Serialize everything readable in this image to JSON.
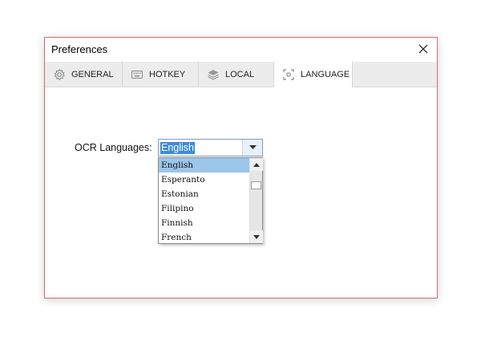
{
  "window": {
    "title": "Preferences"
  },
  "tabs": [
    {
      "label": "GENERAL",
      "icon": "gear-icon",
      "active": false
    },
    {
      "label": "HOTKEY",
      "icon": "keyboard-icon",
      "active": false
    },
    {
      "label": "LOCAL",
      "icon": "layers-icon",
      "active": false
    },
    {
      "label": "LANGUAGE",
      "icon": "scan-icon",
      "active": true
    }
  ],
  "language": {
    "label": "OCR Languages:",
    "selected": "English",
    "options": [
      "English",
      "Esperanto",
      "Estonian",
      "Filipino",
      "Finnish",
      "French"
    ]
  },
  "colors": {
    "window_border": "#d86a6a",
    "selection": "#3e8bd8",
    "list_highlight": "#9cc6ea"
  }
}
